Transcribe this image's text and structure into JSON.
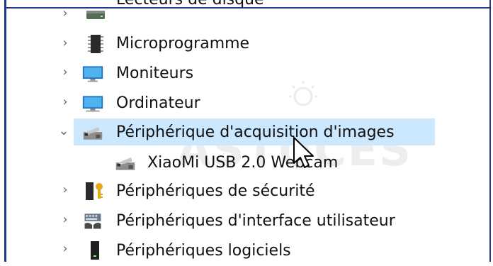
{
  "tree": {
    "items": [
      {
        "label": "Lecteurs de disque",
        "expanded": false,
        "icon": "disk-drive-icon"
      },
      {
        "label": "Microprogramme",
        "expanded": false,
        "icon": "chip-icon"
      },
      {
        "label": "Moniteurs",
        "expanded": false,
        "icon": "monitor-icon"
      },
      {
        "label": "Ordinateur",
        "expanded": false,
        "icon": "computer-icon"
      },
      {
        "label": "Périphérique d'acquisition d'images",
        "expanded": true,
        "selected": true,
        "icon": "camera-device-icon"
      },
      {
        "label": "XiaoMi USB 2.0 Webcam",
        "child": true,
        "icon": "camera-device-icon"
      },
      {
        "label": "Périphériques de sécurité",
        "expanded": false,
        "icon": "security-key-icon"
      },
      {
        "label": "Périphériques d'interface utilisateur",
        "expanded": false,
        "icon": "hid-keyboard-icon"
      },
      {
        "label": "Périphériques logiciels",
        "expanded": false,
        "icon": "software-device-icon"
      }
    ]
  },
  "watermark": {
    "text": "ASTUCES"
  },
  "colors": {
    "selection": "#cce8ff",
    "border": "#1d3a8f",
    "chevron": "#6a6a6a"
  }
}
